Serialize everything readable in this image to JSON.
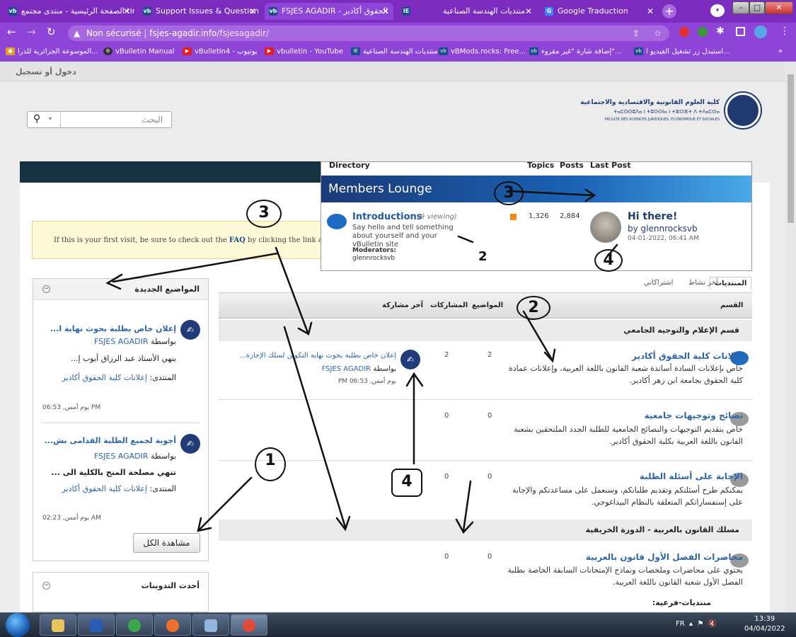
{
  "browser": {
    "tabs": [
      {
        "title": "الصفحة الرئيسية - منتدى مجتمع tin",
        "icon": "vb",
        "active": false
      },
      {
        "title": "Support Issues & Question",
        "icon": "vb",
        "active": false
      },
      {
        "title": "FSJES AGADIR - الحقوق أكادير",
        "icon": "vb",
        "active": true
      },
      {
        "title": "منتديات الهندسة الصناعية",
        "icon": "IE",
        "active": false
      },
      {
        "title": "Google Traduction",
        "icon": "gt",
        "active": false
      }
    ],
    "security_label": "Non sécurisé",
    "url_domain": "fsjes-agadir.info",
    "url_path": "/fsjesagadir/",
    "bookmarks": [
      "الموسوعة الجزائرية للدرا...",
      "vBulletin Manual",
      "vBulletin4 - يوتيوب",
      "vbulletin - YouTube",
      "منتديات الهندسة الصناعية",
      "vBMods.rocks: Free...",
      "إضافة شارة \"غير مقروء\"...",
      "استبدل زر تشغيل الفيديو ا..."
    ]
  },
  "header": {
    "login_link": "دخول أو تسجيل",
    "search_placeholder": "البحث",
    "logo_ar": "كلية العلوم القانونية والاقتصادية والاجتماعية",
    "logo_tif": "ⵜⴰⵎⵙⵙⵓⴷⴰ ⵏ ⵜⵓⵙⵙⵏⴰ ⵏ ⵜⵣⵔⴼⵜ ⴷ ⵜⴷⴰⵎⵙⴰ",
    "logo_fr": "FACULTE DES SCIENCES JURIDIQUES, ECONOMIQUE ET SOCIALES"
  },
  "faq_notice": {
    "before": "If this is your first visit, be sure to check out the ",
    "link": "FAQ",
    "after": " by clicking the link abov"
  },
  "lounge": {
    "col_directory": "Directory",
    "col_topics": "Topics",
    "col_posts": "Posts",
    "col_last": "Last Post",
    "title": "Members Lounge",
    "forum_title": "Introductions",
    "viewing": "(9 viewing)",
    "desc": "Say hello and tell something about yourself and your vBulletin site",
    "moderators_label": "Moderators:",
    "moderator": "glennrocksvb",
    "topics": "1,326",
    "posts": "2,884",
    "last_title": "Hi there!",
    "last_by": "by glennrocksvb",
    "last_date": "04-01-2022, 06:41 AM"
  },
  "sidebar": {
    "title": "المواضيع الجديدة",
    "items": [
      {
        "title": "إعلان خاص بطلبة بحوث نهاية ا...",
        "by": "بواسطة",
        "author": "FSJES AGADIR",
        "excerpt": "ينهي الأستاذ عبد الرزاق أيوب إ...",
        "forum_label": "المنتدى:",
        "forum": "إعلانات كلية الحقوق أكادير",
        "date": "يوم أمس, 06:53 PM"
      },
      {
        "title": "أجوبة لجميع الطلبة القدامى بش...",
        "by": "بواسطة",
        "author": "FSJES AGADIR",
        "excerpt": "تنهي مصلحة المنح بالكلية الى ...",
        "forum_label": "المنتدى:",
        "forum": "إعلانات كلية الحقوق أكادير",
        "date": "يوم أمس, 02:23 AM"
      }
    ],
    "view_all": "مشاهدة الكل",
    "blogs_title": "أحدث التدوينات"
  },
  "forum_tabs": [
    "المنتديات",
    "آخر نشاط",
    "اشتراكاتي"
  ],
  "forum_headers": {
    "section": "القسم",
    "topics": "المواضيع",
    "posts": "المشاركات",
    "last": "آخر مشاركة"
  },
  "sections": [
    {
      "name": "قسم الإعلام والتوجيه الجامعي"
    },
    {
      "name": "مسلك القانون بالعربية - الدورة الخريفية"
    }
  ],
  "forums": [
    {
      "title": "إعلانات كلية الحقوق أكادير",
      "desc": "خاص بإعلانات السادة أساتذة شعبة القانون باللغة العربية، وإعلانات عمادة كلية الحقوق بجامعة ابن زهر أكادير.",
      "topics": "2",
      "posts": "2",
      "last_title": "إعلان خاص بطلبة بحوث نهاية التكوين لسلك الإجازة...",
      "last_by": "بواسطة",
      "last_author": "FSJES AGADIR",
      "last_date": "يوم أمس, 06:53 PM"
    },
    {
      "title": "نصائح وتوجيهات جامعية",
      "desc": "خاص بتقديم التوجيهات والنصائح الجامعية للطلبة الجدد الملتحقين بشعبة القانون باللغة العربية بكلية الحقوق أكادير.",
      "topics": "0",
      "posts": "0"
    },
    {
      "title": "الإجابة على أسئلة الطلبة",
      "desc": "يمكنكم طرح أسئلتكم وتقديم طلباتكم، وسنعمل على مساعدتكم والإجابة على إستفساراتكم المتعلقة بالنظام البيداغوجي.",
      "topics": "0",
      "posts": "0"
    },
    {
      "title": "محاضرات الفصل الأول قانون بالعربية",
      "desc": "يحتوي على محاضرات وملخصات ونماذج الإمتحانات السابقة الخاصة بطلبة الفصل الأول شعبة القانون باللغة العربية.",
      "topics": "0",
      "posts": "0",
      "subforums_label": "منتديات-فرعية:"
    }
  ],
  "annotations": [
    "3",
    "3",
    "2",
    "2",
    "4",
    "4",
    "1"
  ],
  "taskbar": {
    "lang": "FR",
    "time": "13:39",
    "date": "04/04/2022"
  },
  "colors": {
    "browser": "#8e44d6",
    "lounge_header": "#1b63b5",
    "link": "#2e66a8"
  }
}
